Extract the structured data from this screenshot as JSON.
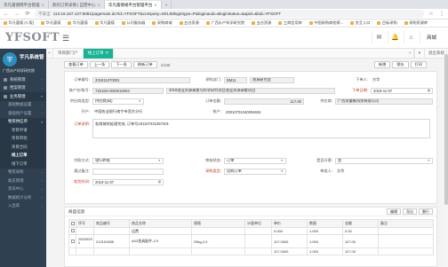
{
  "browser": {
    "tabs": [
      {
        "label": "华凡菌德网平台管理",
        "active": false
      },
      {
        "label": "新的订单详情 | 自营中心",
        "active": false
      },
      {
        "label": "华凡菌德规平台管理平台",
        "active": true
      }
    ],
    "url_warning": "不安全",
    "url": "113.16.167.137:8081/pagemain.do?id=YFSOFT&company=001JMlogintype=P&loginauid=&loginstatus=&apid=&bid=YFSOFT",
    "bookmarks": [
      "华凡菌德 (A 版)",
      "华凡菌德",
      "华凡菌德",
      "华凡菌德",
      "公司服务器",
      "采购商城",
      "五谷资源",
      "广西水产科学研究院",
      "五谷资源",
      "工商信用库",
      "中国采购商检察...",
      "交互入口",
      "目标采购",
      "采购资源库"
    ]
  },
  "topbar": {
    "logo": "YFSOFT",
    "user_label": "商城"
  },
  "sidebar": {
    "avatar_text": "宇",
    "user_name": "宇凡系统管",
    "user_status": "在线",
    "org": "广西水产科学研究院",
    "items": [
      {
        "label": "系统管理",
        "level": "l1"
      },
      {
        "label": "档案管理",
        "level": "l1"
      },
      {
        "label": "业务管理",
        "level": "l1-open"
      },
      {
        "label": "基础数据设置",
        "level": "l2"
      },
      {
        "label": "基础用户设置",
        "level": "l2"
      },
      {
        "label": "物资供应单",
        "level": "l2-open"
      },
      {
        "label": "项目申请",
        "level": "l3"
      },
      {
        "label": "项目审批",
        "level": "l3"
      },
      {
        "label": "项目合同",
        "level": "l3"
      },
      {
        "label": "线上订单",
        "level": "l3-active"
      },
      {
        "label": "线下订单",
        "level": "l3"
      },
      {
        "label": "物资采购",
        "level": "l2"
      },
      {
        "label": "收支管理",
        "level": "l2"
      },
      {
        "label": "资讯中心",
        "level": "l2"
      },
      {
        "label": "数据统计分析",
        "level": "l2"
      },
      {
        "label": "入出库",
        "level": "l2"
      }
    ]
  },
  "crumbs": {
    "home": "项目部门户",
    "current": "线上订单",
    "close_action": "退出系统"
  },
  "toolbar": {
    "buttons": [
      "查看订单",
      "上一条",
      "下一条",
      "刷新订单"
    ],
    "counter": "1/198",
    "right_buttons": [
      "新增",
      "保存",
      "打印"
    ]
  },
  "form": {
    "order_no_label": "订单编号:",
    "order_no": "201811070001",
    "dept_label": "采购部门:",
    "dept_code": "BM11",
    "dept_name": "渔具研究室",
    "orderer_label": "下单人:",
    "orderer": "方华",
    "account_label": "账户名/账号:",
    "account": "720183-0030010003",
    "project": "2018渔业资源调查与科学研究项目渔业资源调查项目",
    "order_date_label": "下单日期:",
    "order_date": "2019-11-07",
    "supplier_type_label": "供应商类型:",
    "supplier_type": "供应商(网)",
    "amount_label": "订单金额:",
    "amount": "117.00",
    "supplier_label": "供应商:",
    "supplier": "广西荣重象科技有限公司",
    "contract_label": "开户:",
    "contract": "中国农业银行南宁市西大分行",
    "account_no_label": "账户:",
    "account_no": "20010701040004634",
    "remark_label": "订单说明:",
    "remark": "各商城的处理完成, 订单号191107231357401",
    "delivery_label": "付款方式:",
    "delivery": "银行转账",
    "status_label": "审核状态:",
    "status": "已审",
    "invoice_label": "是否开票:",
    "invoice": "是",
    "goods_type_label": "通过备注:",
    "contract_type_label": "采购类型:",
    "contract_type": "自购订单",
    "approver_label": "审批人:",
    "approver": "方华",
    "deliver_date_label": "收货时间:",
    "deliver_date": "2019-11-07"
  },
  "goods": {
    "title": "商品信息",
    "actions": [
      "编辑",
      "导出",
      "删行"
    ],
    "columns": [
      "序号",
      "商品编号",
      "商品名称",
      "规格",
      "计量单位",
      "单价",
      "数量",
      "金额",
      "备注"
    ],
    "rows": [
      {
        "no": "",
        "code": "",
        "name": "运费",
        "spec": "",
        "unit": "",
        "price": "0.000",
        "qty": "1.000",
        "amount": "0.00",
        "note": ""
      },
      {
        "no": "",
        "code": "200305784",
        "name": "A02渔具配件-2.0",
        "spec": "25kg,2.0",
        "unit": "",
        "price": "117.0000",
        "qty": "1.000",
        "amount": "117.00",
        "note": ""
      },
      {
        "no": "",
        "code": "",
        "name": "",
        "spec": "",
        "unit": "",
        "price": "117.0000",
        "qty": "1.000",
        "amount": "117.00",
        "note": ""
      }
    ],
    "row_index": "20030578 4",
    "second_code": "212151555"
  },
  "colors": {
    "accent": "#1ab394",
    "sidebar_bg": "#2f4050"
  }
}
